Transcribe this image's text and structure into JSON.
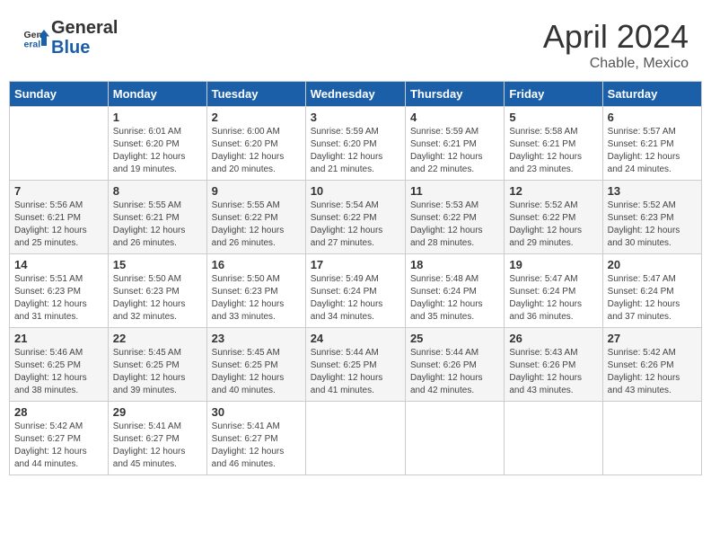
{
  "header": {
    "logo_general": "General",
    "logo_blue": "Blue",
    "month_year": "April 2024",
    "location": "Chable, Mexico"
  },
  "weekdays": [
    "Sunday",
    "Monday",
    "Tuesday",
    "Wednesday",
    "Thursday",
    "Friday",
    "Saturday"
  ],
  "weeks": [
    [
      {
        "day": "",
        "info": ""
      },
      {
        "day": "1",
        "info": "Sunrise: 6:01 AM\nSunset: 6:20 PM\nDaylight: 12 hours\nand 19 minutes."
      },
      {
        "day": "2",
        "info": "Sunrise: 6:00 AM\nSunset: 6:20 PM\nDaylight: 12 hours\nand 20 minutes."
      },
      {
        "day": "3",
        "info": "Sunrise: 5:59 AM\nSunset: 6:20 PM\nDaylight: 12 hours\nand 21 minutes."
      },
      {
        "day": "4",
        "info": "Sunrise: 5:59 AM\nSunset: 6:21 PM\nDaylight: 12 hours\nand 22 minutes."
      },
      {
        "day": "5",
        "info": "Sunrise: 5:58 AM\nSunset: 6:21 PM\nDaylight: 12 hours\nand 23 minutes."
      },
      {
        "day": "6",
        "info": "Sunrise: 5:57 AM\nSunset: 6:21 PM\nDaylight: 12 hours\nand 24 minutes."
      }
    ],
    [
      {
        "day": "7",
        "info": "Sunrise: 5:56 AM\nSunset: 6:21 PM\nDaylight: 12 hours\nand 25 minutes."
      },
      {
        "day": "8",
        "info": "Sunrise: 5:55 AM\nSunset: 6:21 PM\nDaylight: 12 hours\nand 26 minutes."
      },
      {
        "day": "9",
        "info": "Sunrise: 5:55 AM\nSunset: 6:22 PM\nDaylight: 12 hours\nand 26 minutes."
      },
      {
        "day": "10",
        "info": "Sunrise: 5:54 AM\nSunset: 6:22 PM\nDaylight: 12 hours\nand 27 minutes."
      },
      {
        "day": "11",
        "info": "Sunrise: 5:53 AM\nSunset: 6:22 PM\nDaylight: 12 hours\nand 28 minutes."
      },
      {
        "day": "12",
        "info": "Sunrise: 5:52 AM\nSunset: 6:22 PM\nDaylight: 12 hours\nand 29 minutes."
      },
      {
        "day": "13",
        "info": "Sunrise: 5:52 AM\nSunset: 6:23 PM\nDaylight: 12 hours\nand 30 minutes."
      }
    ],
    [
      {
        "day": "14",
        "info": "Sunrise: 5:51 AM\nSunset: 6:23 PM\nDaylight: 12 hours\nand 31 minutes."
      },
      {
        "day": "15",
        "info": "Sunrise: 5:50 AM\nSunset: 6:23 PM\nDaylight: 12 hours\nand 32 minutes."
      },
      {
        "day": "16",
        "info": "Sunrise: 5:50 AM\nSunset: 6:23 PM\nDaylight: 12 hours\nand 33 minutes."
      },
      {
        "day": "17",
        "info": "Sunrise: 5:49 AM\nSunset: 6:24 PM\nDaylight: 12 hours\nand 34 minutes."
      },
      {
        "day": "18",
        "info": "Sunrise: 5:48 AM\nSunset: 6:24 PM\nDaylight: 12 hours\nand 35 minutes."
      },
      {
        "day": "19",
        "info": "Sunrise: 5:47 AM\nSunset: 6:24 PM\nDaylight: 12 hours\nand 36 minutes."
      },
      {
        "day": "20",
        "info": "Sunrise: 5:47 AM\nSunset: 6:24 PM\nDaylight: 12 hours\nand 37 minutes."
      }
    ],
    [
      {
        "day": "21",
        "info": "Sunrise: 5:46 AM\nSunset: 6:25 PM\nDaylight: 12 hours\nand 38 minutes."
      },
      {
        "day": "22",
        "info": "Sunrise: 5:45 AM\nSunset: 6:25 PM\nDaylight: 12 hours\nand 39 minutes."
      },
      {
        "day": "23",
        "info": "Sunrise: 5:45 AM\nSunset: 6:25 PM\nDaylight: 12 hours\nand 40 minutes."
      },
      {
        "day": "24",
        "info": "Sunrise: 5:44 AM\nSunset: 6:25 PM\nDaylight: 12 hours\nand 41 minutes."
      },
      {
        "day": "25",
        "info": "Sunrise: 5:44 AM\nSunset: 6:26 PM\nDaylight: 12 hours\nand 42 minutes."
      },
      {
        "day": "26",
        "info": "Sunrise: 5:43 AM\nSunset: 6:26 PM\nDaylight: 12 hours\nand 43 minutes."
      },
      {
        "day": "27",
        "info": "Sunrise: 5:42 AM\nSunset: 6:26 PM\nDaylight: 12 hours\nand 43 minutes."
      }
    ],
    [
      {
        "day": "28",
        "info": "Sunrise: 5:42 AM\nSunset: 6:27 PM\nDaylight: 12 hours\nand 44 minutes."
      },
      {
        "day": "29",
        "info": "Sunrise: 5:41 AM\nSunset: 6:27 PM\nDaylight: 12 hours\nand 45 minutes."
      },
      {
        "day": "30",
        "info": "Sunrise: 5:41 AM\nSunset: 6:27 PM\nDaylight: 12 hours\nand 46 minutes."
      },
      {
        "day": "",
        "info": ""
      },
      {
        "day": "",
        "info": ""
      },
      {
        "day": "",
        "info": ""
      },
      {
        "day": "",
        "info": ""
      }
    ]
  ]
}
